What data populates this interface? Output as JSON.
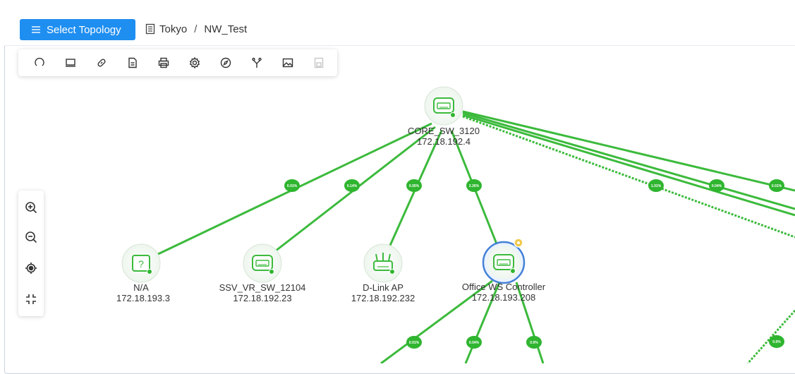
{
  "header": {
    "select_topology_label": "Select Topology",
    "breadcrumb_site": "Tokyo",
    "breadcrumb_separator": "/",
    "breadcrumb_map": "NW_Test"
  },
  "toolbar": {
    "tools": [
      "refresh-icon",
      "device-icon",
      "link-icon",
      "document-icon",
      "print-icon",
      "settings-icon",
      "compass-icon",
      "branch-icon",
      "image-icon",
      "save-icon"
    ],
    "disabled": [
      "save-icon"
    ]
  },
  "zoom_controls": [
    "zoom-in-icon",
    "zoom-out-icon",
    "locate-icon",
    "fit-screen-icon"
  ],
  "colors": {
    "accent": "#1f8ef1",
    "link": "#3cba3c",
    "badge": "#2fb52f",
    "highlight": "#3a7bd5",
    "warn": "#f2c94c"
  },
  "nodes": {
    "core": {
      "name": "CORE_SW_3120",
      "ip": "172.18.192.4",
      "icon": "switch-icon"
    },
    "na": {
      "name": "N/A",
      "ip": "172.18.193.3",
      "icon": "unknown-device-icon"
    },
    "ssv": {
      "name": "SSV_VR_SW_12104",
      "ip": "172.18.192.23",
      "icon": "switch-icon"
    },
    "dlink": {
      "name": "D-Link AP",
      "ip": "172.18.192.232",
      "icon": "access-point-icon"
    },
    "office": {
      "name": "Office WS Controller",
      "ip": "172.18.193.208",
      "icon": "switch-icon"
    }
  },
  "link_badges": {
    "core_na": "0.01%",
    "core_ssv": "0.14%",
    "core_dlink": "0.05%",
    "core_office": "2.26%",
    "core_r1": "1.01%",
    "core_r2": "0.04%",
    "core_r3": "0.01%",
    "office_c1": "0.01%",
    "office_c2": "0.04%",
    "office_c3": "0.0%",
    "right_bottom": "0.0%"
  }
}
